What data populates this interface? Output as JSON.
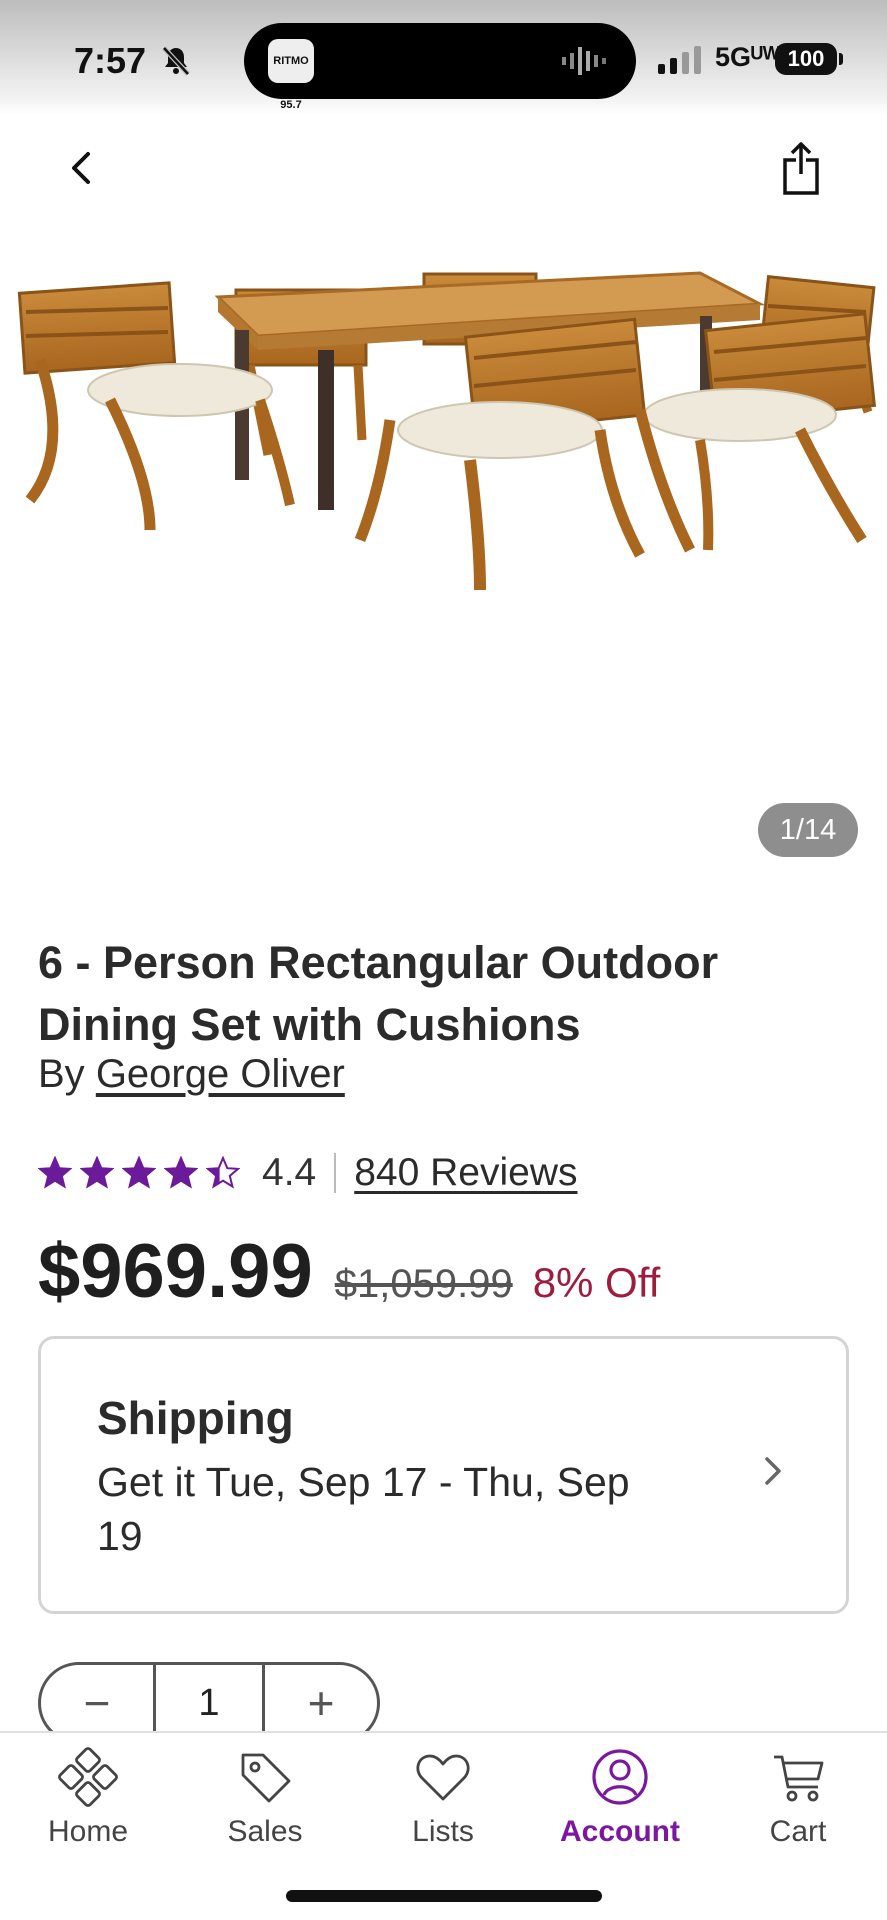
{
  "status_bar": {
    "time": "7:57",
    "island_app_label": "RITMO 95.7",
    "network": "5Gᵁᵂ",
    "battery": "100"
  },
  "nav": {
    "back_icon": "chevron-left-icon",
    "share_icon": "share-icon"
  },
  "gallery": {
    "counter": "1/14"
  },
  "product": {
    "title": "6 - Person Rectangular Outdoor Dining Set with Cushions",
    "by_prefix": "By",
    "brand": "George Oliver",
    "rating": "4.4",
    "rating_fraction": 0.88,
    "reviews_label": "840 Reviews",
    "price": "$969.99",
    "original_price": "$1,059.99",
    "discount": "8% Off"
  },
  "shipping": {
    "title": "Shipping",
    "text": "Get it Tue, Sep 17 - Thu, Sep 19"
  },
  "quantity": {
    "minus": "−",
    "value": "1",
    "plus": "+"
  },
  "tabs": [
    {
      "label": "Home",
      "icon": "home-icon",
      "active": false
    },
    {
      "label": "Sales",
      "icon": "tag-icon",
      "active": false
    },
    {
      "label": "Lists",
      "icon": "heart-icon",
      "active": false
    },
    {
      "label": "Account",
      "icon": "account-icon",
      "active": true
    },
    {
      "label": "Cart",
      "icon": "cart-icon",
      "active": false
    }
  ],
  "colors": {
    "accent": "#7b189f",
    "star": "#6b1a9a",
    "discount": "#9d1d3f"
  }
}
